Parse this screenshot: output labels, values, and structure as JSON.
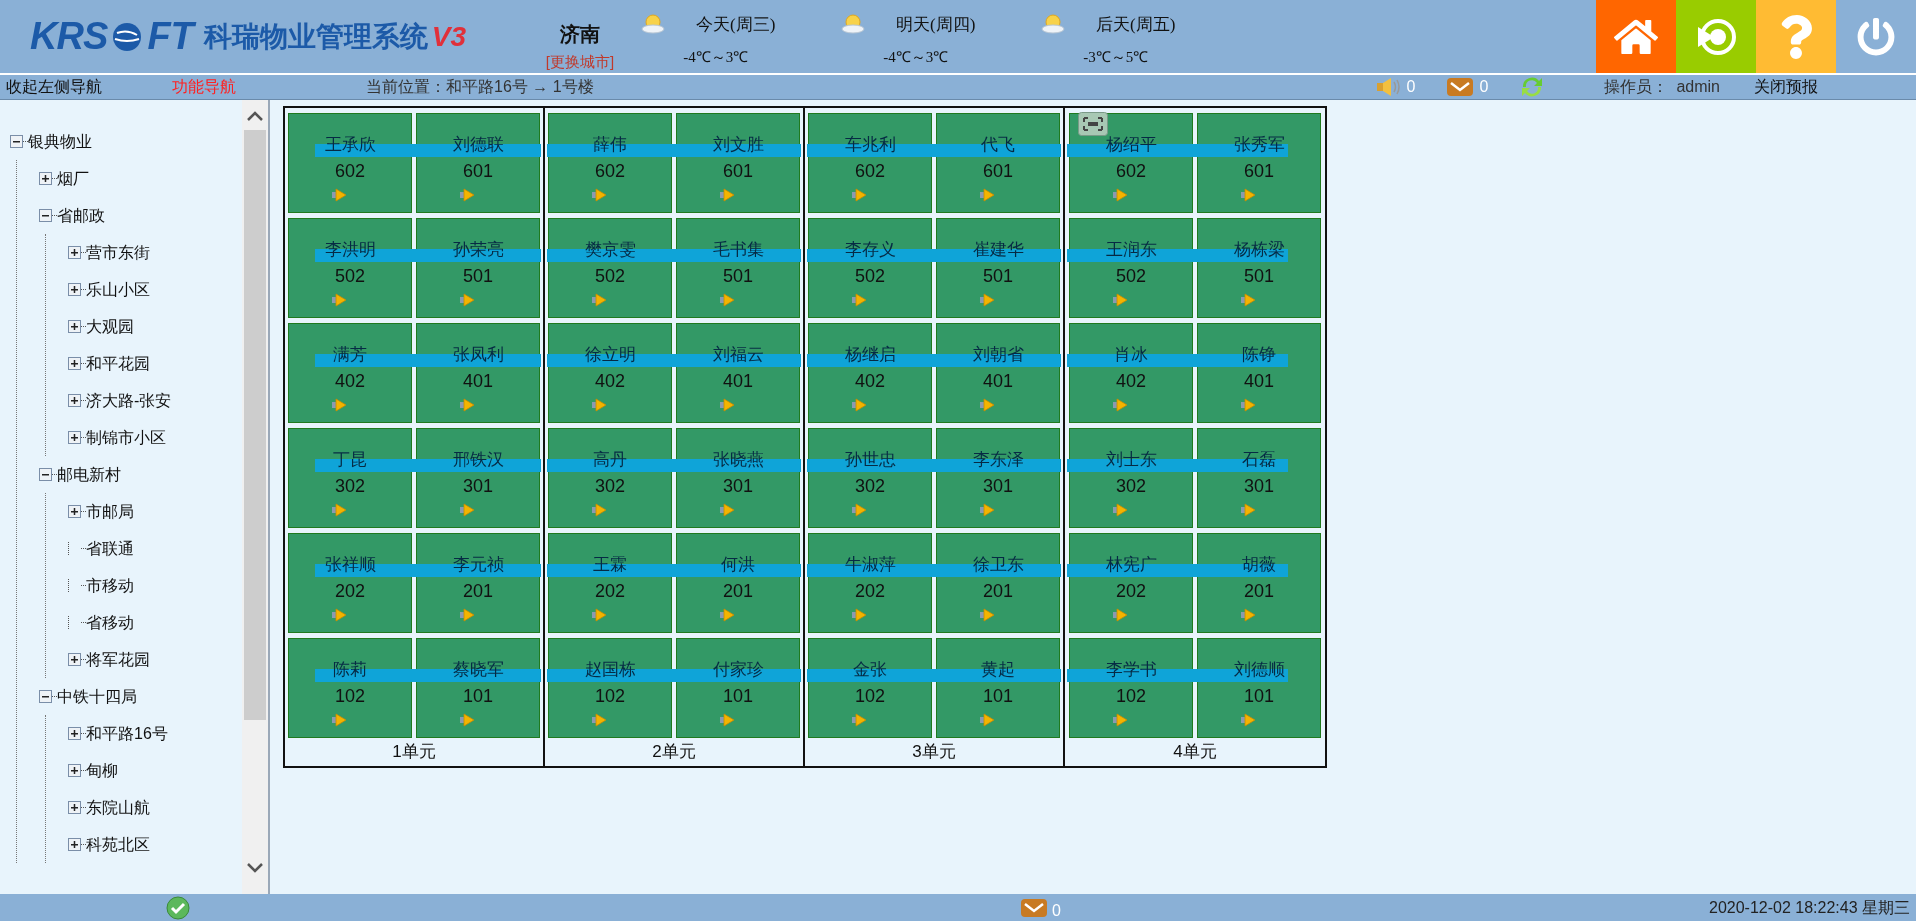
{
  "header": {
    "logo": {
      "brand_left": "KRS",
      "brand_right": "FT",
      "product": "科瑞物业管理系统",
      "version": "V3"
    },
    "city": {
      "name": "济南",
      "change_link": "[更换城市]"
    },
    "forecast": [
      {
        "day": "今天(周三)",
        "temp": "-4℃～3℃"
      },
      {
        "day": "明天(周四)",
        "temp": "-4℃～3℃"
      },
      {
        "day": "后天(周五)",
        "temp": "-3℃～5℃"
      }
    ],
    "buttons": [
      {
        "kind": "home"
      },
      {
        "kind": "enter"
      },
      {
        "kind": "help"
      },
      {
        "kind": "power"
      }
    ]
  },
  "nav_bar": {
    "collapse_link": "收起左侧导航",
    "function_link": "功能导航",
    "breadcrumb": "当前位置：和平路16号 → 1号楼",
    "sound_count": "0",
    "mail_count": "0",
    "operator_label": "操作员：",
    "operator": "admin",
    "close_forecast": "关闭预报"
  },
  "tree": [
    {
      "label": "银典物业",
      "kind": "folder",
      "expanded": true,
      "children": [
        {
          "label": "烟厂",
          "kind": "folder",
          "expanded": false
        },
        {
          "label": "省邮政",
          "kind": "folder",
          "expanded": true,
          "children": [
            {
              "label": "营市东街",
              "kind": "folder",
              "expanded": false
            },
            {
              "label": "乐山小区",
              "kind": "folder",
              "expanded": false
            },
            {
              "label": "大观园",
              "kind": "folder",
              "expanded": false
            },
            {
              "label": "和平花园",
              "kind": "folder",
              "expanded": false
            },
            {
              "label": "济大路-张安",
              "kind": "folder",
              "expanded": false
            },
            {
              "label": "制锦市小区",
              "kind": "folder",
              "expanded": false
            }
          ]
        },
        {
          "label": "邮电新村",
          "kind": "folder",
          "expanded": true,
          "children": [
            {
              "label": "市邮局",
              "kind": "folder",
              "expanded": false
            },
            {
              "label": "省联通",
              "kind": "leaf"
            },
            {
              "label": "市移动",
              "kind": "leaf"
            },
            {
              "label": "省移动",
              "kind": "leaf"
            },
            {
              "label": "将军花园",
              "kind": "folder",
              "expanded": false
            }
          ]
        },
        {
          "label": "中铁十四局",
          "kind": "folder",
          "expanded": true,
          "children": [
            {
              "label": "和平路16号",
              "kind": "folder",
              "expanded": false
            },
            {
              "label": "甸柳",
              "kind": "folder",
              "expanded": false
            },
            {
              "label": "东院山航",
              "kind": "folder",
              "expanded": false
            },
            {
              "label": "科苑北区",
              "kind": "folder",
              "expanded": false
            }
          ]
        }
      ]
    }
  ],
  "units": [
    {
      "label": "1单元",
      "floors": [
        [
          {
            "name": "王承欣",
            "number": "602"
          },
          {
            "name": "刘德联",
            "number": "601"
          }
        ],
        [
          {
            "name": "李洪明",
            "number": "502"
          },
          {
            "name": "孙荣亮",
            "number": "501"
          }
        ],
        [
          {
            "name": "满芳",
            "number": "402"
          },
          {
            "name": "张凤利",
            "number": "401"
          }
        ],
        [
          {
            "name": "丁昆",
            "number": "302"
          },
          {
            "name": "邢铁汉",
            "number": "301"
          }
        ],
        [
          {
            "name": "张祥顺",
            "number": "202"
          },
          {
            "name": "李元祯",
            "number": "201"
          }
        ],
        [
          {
            "name": "陈莉",
            "number": "102"
          },
          {
            "name": "蔡晓军",
            "number": "101"
          }
        ]
      ]
    },
    {
      "label": "2单元",
      "floors": [
        [
          {
            "name": "薛伟",
            "number": "602"
          },
          {
            "name": "刘文胜",
            "number": "601"
          }
        ],
        [
          {
            "name": "樊京雯",
            "number": "502"
          },
          {
            "name": "毛书集",
            "number": "501"
          }
        ],
        [
          {
            "name": "徐立明",
            "number": "402"
          },
          {
            "name": "刘福云",
            "number": "401"
          }
        ],
        [
          {
            "name": "高丹",
            "number": "302"
          },
          {
            "name": "张晓燕",
            "number": "301"
          }
        ],
        [
          {
            "name": "王霖",
            "number": "202"
          },
          {
            "name": "何洪",
            "number": "201"
          }
        ],
        [
          {
            "name": "赵国栋",
            "number": "102"
          },
          {
            "name": "付家珍",
            "number": "101"
          }
        ]
      ]
    },
    {
      "label": "3单元",
      "floors": [
        [
          {
            "name": "车兆利",
            "number": "602"
          },
          {
            "name": "代飞",
            "number": "601"
          }
        ],
        [
          {
            "name": "李存义",
            "number": "502"
          },
          {
            "name": "崔建华",
            "number": "501"
          }
        ],
        [
          {
            "name": "杨继启",
            "number": "402"
          },
          {
            "name": "刘朝省",
            "number": "401"
          }
        ],
        [
          {
            "name": "孙世忠",
            "number": "302"
          },
          {
            "name": "李东泽",
            "number": "301"
          }
        ],
        [
          {
            "name": "牛淑萍",
            "number": "202"
          },
          {
            "name": "徐卫东",
            "number": "201"
          }
        ],
        [
          {
            "name": "金张",
            "number": "102"
          },
          {
            "name": "黄起",
            "number": "101"
          }
        ]
      ]
    },
    {
      "label": "4单元",
      "floors": [
        [
          {
            "name": "杨绍平",
            "number": "602",
            "marked": true
          },
          {
            "name": "张秀军",
            "number": "601"
          }
        ],
        [
          {
            "name": "王润东",
            "number": "502"
          },
          {
            "name": "杨栋梁",
            "number": "501"
          }
        ],
        [
          {
            "name": "肖冰",
            "number": "402"
          },
          {
            "name": "陈铮",
            "number": "401"
          }
        ],
        [
          {
            "name": "刘士东",
            "number": "302"
          },
          {
            "name": "石磊",
            "number": "301"
          }
        ],
        [
          {
            "name": "林宪广",
            "number": "202"
          },
          {
            "name": "胡薇",
            "number": "201"
          }
        ],
        [
          {
            "name": "李学书",
            "number": "102"
          },
          {
            "name": "刘德顺",
            "number": "101"
          }
        ]
      ]
    }
  ],
  "status_bar": {
    "mail_count": "0",
    "datetime": "2020-12-02 18:22:43 星期三"
  }
}
